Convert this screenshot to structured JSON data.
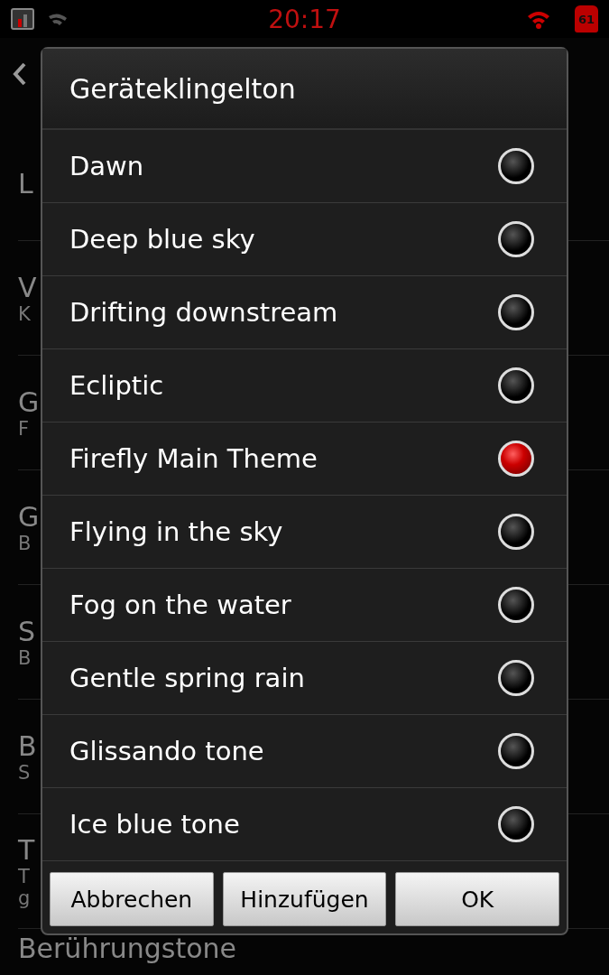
{
  "status_bar": {
    "time": "20:17",
    "battery": "61"
  },
  "background": {
    "groups": [
      {
        "title": "L"
      },
      {
        "title": "V",
        "lines": [
          "K"
        ]
      },
      {
        "title": "G",
        "lines": [
          "F"
        ]
      },
      {
        "title": "G",
        "lines": [
          "B"
        ]
      },
      {
        "title": "S",
        "lines": [
          "B"
        ]
      },
      {
        "title": "B",
        "lines": [
          "S"
        ]
      },
      {
        "title": "T",
        "lines": [
          "T",
          "g"
        ]
      },
      {
        "title": "Berührungstone"
      }
    ]
  },
  "dialog": {
    "title": "Geräteklingelton",
    "options": [
      {
        "label": "Dawn",
        "selected": false
      },
      {
        "label": "Deep blue sky",
        "selected": false
      },
      {
        "label": "Drifting downstream",
        "selected": false
      },
      {
        "label": "Ecliptic",
        "selected": false
      },
      {
        "label": "Firefly Main Theme",
        "selected": true
      },
      {
        "label": "Flying in the sky",
        "selected": false
      },
      {
        "label": "Fog on the water",
        "selected": false
      },
      {
        "label": "Gentle spring rain",
        "selected": false
      },
      {
        "label": "Glissando tone",
        "selected": false
      },
      {
        "label": "Ice blue tone",
        "selected": false
      }
    ],
    "buttons": [
      "Abbrechen",
      "Hinzufügen",
      "OK"
    ]
  }
}
